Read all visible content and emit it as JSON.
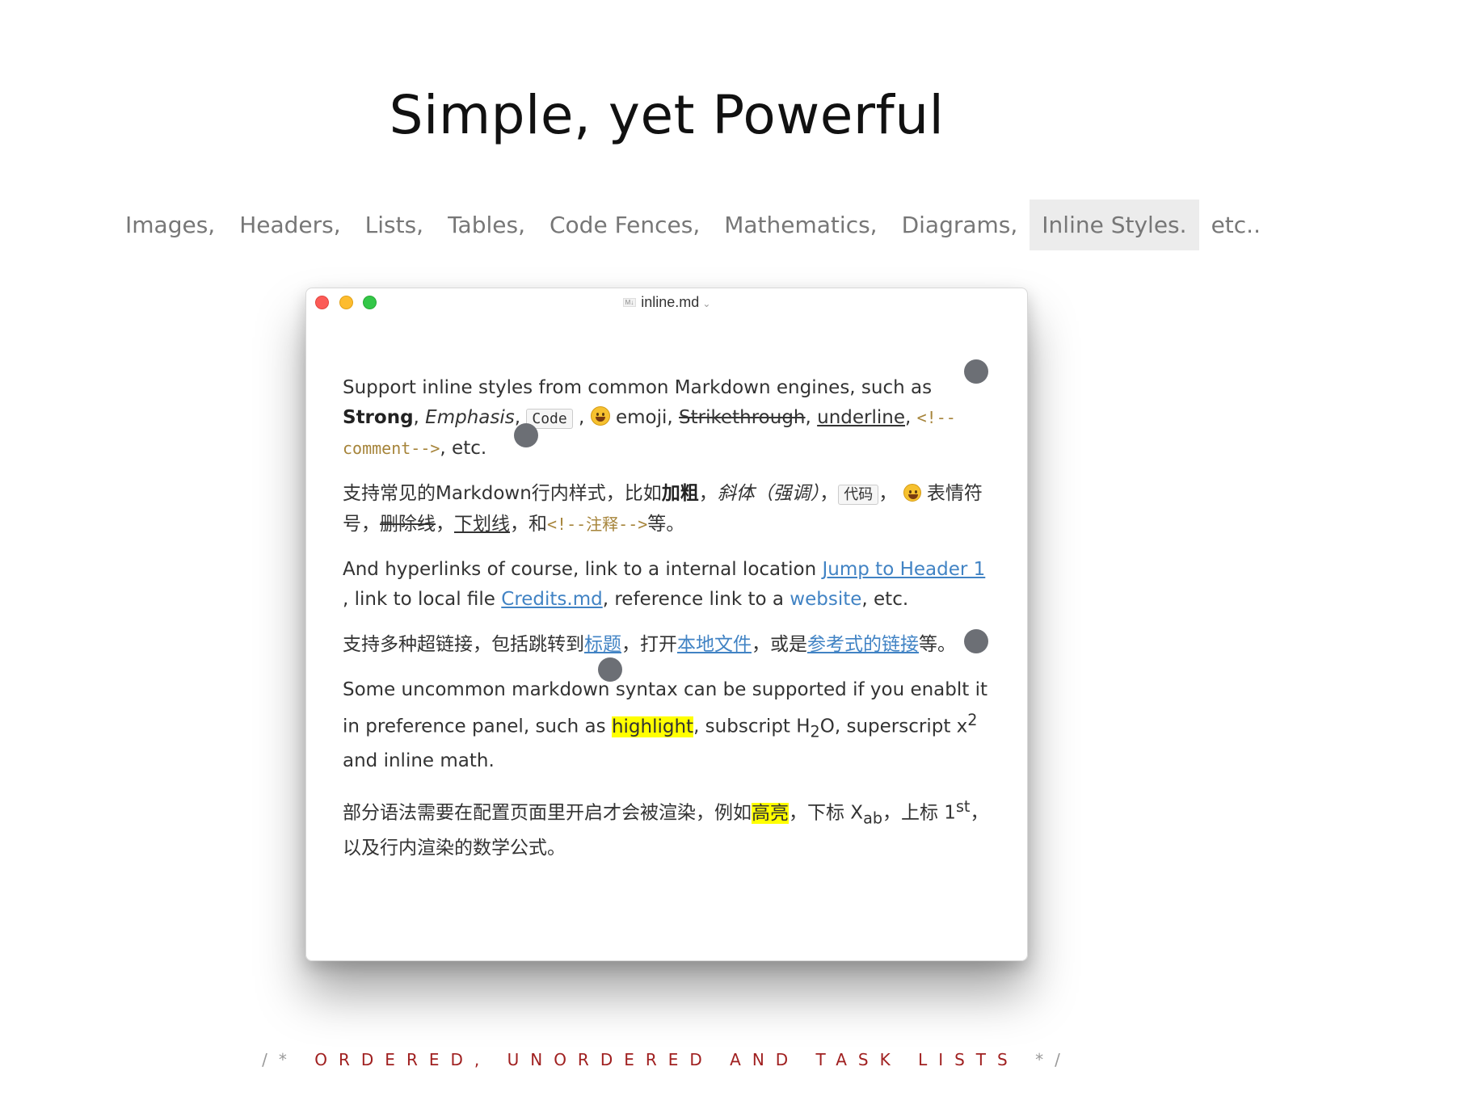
{
  "hero": {
    "title": "Simple, yet Powerful"
  },
  "feature_tabs": [
    {
      "label": "Images,",
      "active": false
    },
    {
      "label": "Headers,",
      "active": false
    },
    {
      "label": "Lists,",
      "active": false
    },
    {
      "label": "Tables,",
      "active": false
    },
    {
      "label": "Code Fences,",
      "active": false
    },
    {
      "label": "Mathematics,",
      "active": false
    },
    {
      "label": "Diagrams,",
      "active": false
    },
    {
      "label": "Inline Styles.",
      "active": true
    },
    {
      "label": "etc..",
      "active": false
    }
  ],
  "window": {
    "title": "inline.md",
    "file_icon": "markdown-file-icon",
    "traffic_colors": {
      "close": "#fc5b57",
      "minimize": "#fdbc2e",
      "maximize": "#33c748"
    }
  },
  "doc": {
    "p1": {
      "intro": "Support inline styles from common Markdown engines, such as ",
      "strong": "Strong",
      "comma1": ",",
      "emphasis": "Emphasis",
      "comma2": ", ",
      "code": "Code",
      "comma3": " , ",
      "emoji_word": " emoji, ",
      "strike": "Strikethrough",
      "comma4": ", ",
      "underline": "underline",
      "comma5": ", ",
      "comment": "<!--comment-->",
      "tail": ", etc."
    },
    "p2": {
      "intro": "支持常见的Markdown行内样式，比如",
      "bold": "加粗",
      "sep1": "，",
      "italic": "斜体（强调）",
      "sep2": "，",
      "code": "代码",
      "sep3": "，",
      "emoji_word": " 表情符号，",
      "strike": "删除线",
      "sep4": "，",
      "underline": "下划线",
      "sep5": "，和",
      "comment": "<!--注释-->",
      "tail": "等。"
    },
    "p3": {
      "intro": "And hyperlinks of course, link to a internal location ",
      "link1": "Jump to Header 1",
      "mid1": " , link to local file ",
      "link2": "Credits.md",
      "mid2": ", reference link to a ",
      "link3": "website",
      "tail": ", etc."
    },
    "p4": {
      "intro": "支持多种超链接，包括跳转到",
      "link1": "标题",
      "mid1": "，打开",
      "link2": "本地文件",
      "mid2": "，或是",
      "link3": "参考式的链接",
      "tail": "等。"
    },
    "p5": {
      "intro": "Some uncommon markdown syntax can be supported if you enablt it in preference panel, such as ",
      "highlight": "highlight",
      "mid1": ", subscript H",
      "sub": "2",
      "mid2": "O, superscript x",
      "sup": "2",
      "tail": " and inline math."
    },
    "p6": {
      "intro": "部分语法需要在配置页面里开启才会被渲染，例如",
      "highlight": "高亮",
      "mid1": "，下标 X",
      "sub": "ab",
      "mid2": "，上标 1",
      "sup": "st",
      "tail": "，以及行内渲染的数学公式。"
    }
  },
  "footer": {
    "open": "/* ",
    "caption": "ORDERED, UNORDERED AND TASK LISTS",
    "close": " */"
  }
}
